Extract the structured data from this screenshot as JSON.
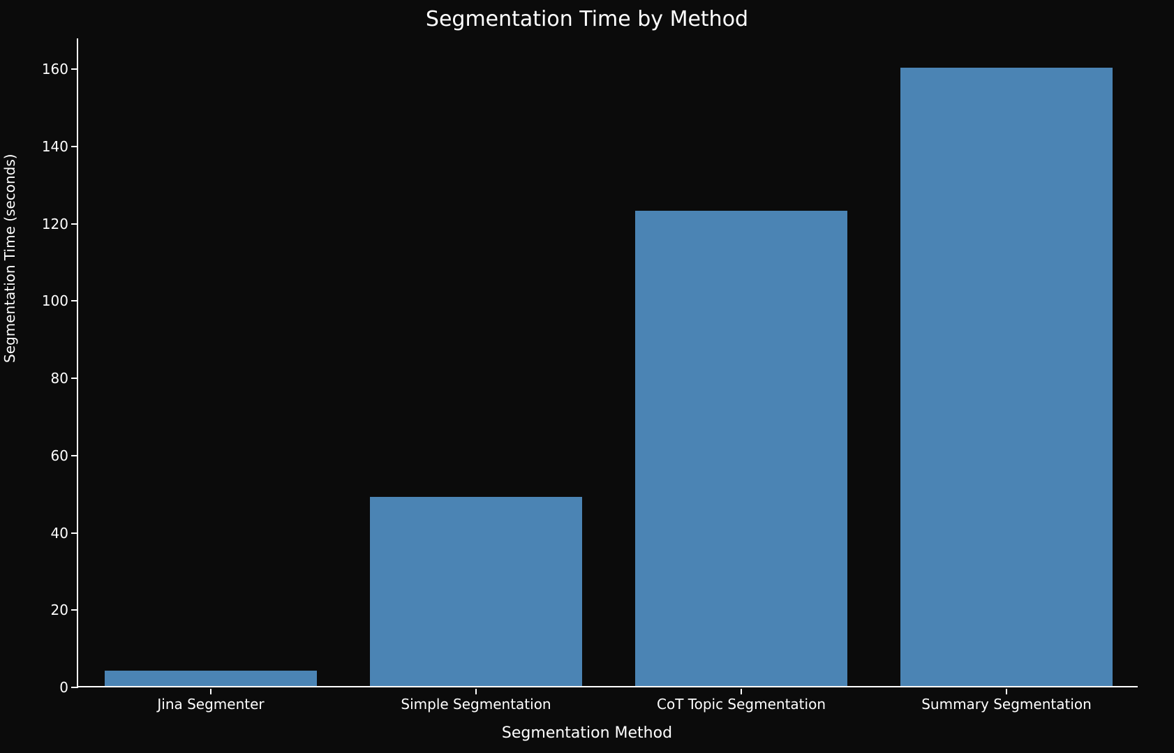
{
  "chart_data": {
    "type": "bar",
    "title": "Segmentation Time by Method",
    "xlabel": "Segmentation Method",
    "ylabel": "Segmentation Time (seconds)",
    "categories": [
      "Jina Segmenter",
      "Simple Segmentation",
      "CoT Topic Segmentation",
      "Summary Segmentation"
    ],
    "values": [
      4,
      49,
      123,
      160
    ],
    "ylim": [
      0,
      168
    ],
    "yticks": [
      0,
      20,
      40,
      60,
      80,
      100,
      120,
      140,
      160
    ],
    "bar_color": "#4b84b4",
    "background": "#0b0b0b",
    "text_color": "#ffffff"
  }
}
